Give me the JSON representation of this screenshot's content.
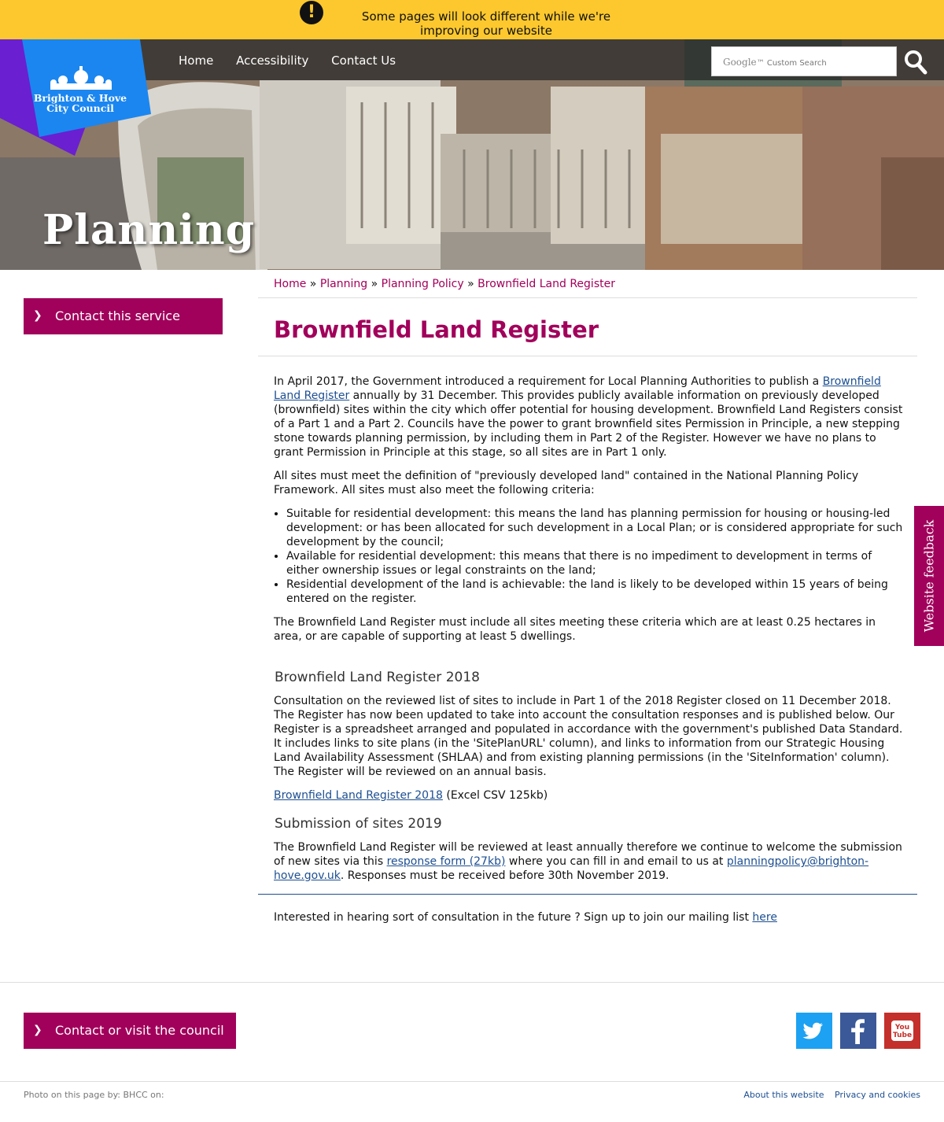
{
  "banner": {
    "message": "Some pages will look different while we're improving our website"
  },
  "logo": {
    "line1": "Brighton & Hove",
    "line2": "City Council"
  },
  "nav": {
    "home": "Home",
    "accessibility": "Accessibility",
    "contact": "Contact Us"
  },
  "search": {
    "google": "Google",
    "label": "Custom Search"
  },
  "hero": {
    "title": "Planning"
  },
  "sidebar": {
    "contact_service": "Contact this service"
  },
  "breadcrumb": {
    "home": "Home",
    "planning": "Planning",
    "policy": "Planning Policy",
    "current": "Brownfield Land Register",
    "sep": "»"
  },
  "page": {
    "title": "Brownfield Land Register",
    "p1_a": "In April 2017, the Government introduced a requirement for Local Planning Authorities to publish a ",
    "p1_link": "Brownfield Land Register",
    "p1_b": " annually by 31 December. This provides publicly available information on previously developed (brownfield) sites within the city which offer potential for housing development. Brownfield Land Registers consist of a Part 1 and a Part 2. Councils have the power to grant brownfield sites Permission in Principle, a new stepping stone towards planning permission, by including them in Part 2 of the Register. However we have no plans to grant Permission in Principle at this stage, so all sites are in Part 1 only.",
    "p2": "All sites must meet the definition of \"previously developed land\" contained in the National Planning Policy Framework. All sites must also meet the following criteria:",
    "criteria": [
      "Suitable for residential development: this means the land has planning permission for housing or housing-led development: or has been allocated for such development in a Local Plan; or is considered appropriate for such development by the council;",
      "Available for residential development: this means that there is no impediment to development in terms of either ownership issues or legal constraints on the land;",
      "Residential development of the land is achievable: the land is likely to be developed within 15 years of being entered on the register."
    ],
    "p3": "The Brownfield Land Register must include all sites meeting these criteria which are at least 0.25 hectares in area, or are capable of supporting at least 5 dwellings.",
    "h2_2018": "Brownfield Land Register 2018",
    "p4": "Consultation on the reviewed list of sites to include in Part 1 of the 2018 Register closed on 11 December 2018. The Register has now been updated to take into account the consultation responses and is published below. Our Register is a spreadsheet arranged and populated in accordance with the government's published Data Standard. It includes links to site plans (in the 'SitePlanURL' column), and links to information from our Strategic Housing Land Availability Assessment (SHLAA) and from existing planning permissions (in the 'SiteInformation' column). The Register will be reviewed on an annual basis.",
    "download_link": "Brownfield Land Register 2018",
    "download_meta": " (Excel CSV 125kb)",
    "h2_2019": "Submission of sites 2019",
    "p5_a": "The Brownfield Land Register will be reviewed at least annually therefore we continue to welcome the submission of new sites via this ",
    "p5_link1": "response form (27kb)",
    "p5_b": " where you can fill in and email to us at ",
    "p5_link2": "planningpolicy@brighton-hove.gov.uk",
    "p5_c": ". Responses must be received before 30th November 2019.",
    "mailing_text": "Interested in hearing sort of consultation in the future ? Sign up to join our mailing list ",
    "mailing_link": "here"
  },
  "feedback": {
    "label": "Website feedback"
  },
  "footer": {
    "contact_visit": "Contact or visit the council",
    "credits": "Photo on this page by: BHCC on:",
    "about": "About this website",
    "privacy": "Privacy and cookies",
    "youtube_label": "You Tube"
  },
  "colors": {
    "accent": "#a1005b",
    "banner": "#fcc82e",
    "link": "#1d4f91",
    "twitter": "#1da1f2",
    "facebook": "#3b5998",
    "youtube": "#c4302b"
  },
  "icons": [
    "alert-icon",
    "search-icon",
    "chevron-right-icon",
    "twitter-icon",
    "facebook-icon",
    "youtube-icon"
  ]
}
